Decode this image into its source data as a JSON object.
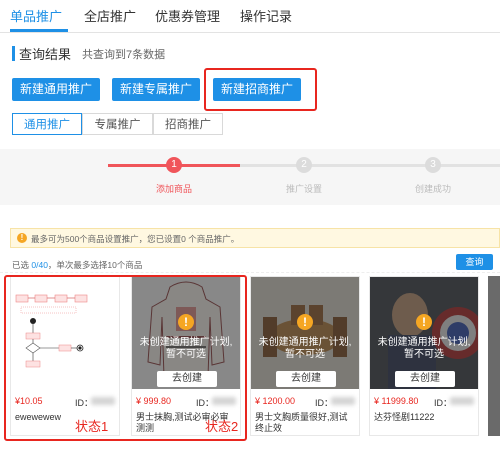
{
  "top_tabs": [
    "单品推广",
    "全店推广",
    "优惠券管理",
    "操作记录"
  ],
  "results": {
    "title": "查询结果",
    "count_text": "共查询到7条数据"
  },
  "buttons": {
    "general": "新建通用推广",
    "exclusive": "新建专属推广",
    "merchant": "新建招商推广"
  },
  "sub_tabs": [
    "通用推广",
    "专属推广",
    "招商推广"
  ],
  "steps": [
    {
      "num": "1",
      "label": "添加商品",
      "state": "active"
    },
    {
      "num": "2",
      "label": "推广设置",
      "state": "inactive"
    },
    {
      "num": "3",
      "label": "创建成功",
      "state": "inactive"
    }
  ],
  "notice": {
    "text": "最多可为500个商品设置推广，您已设置0 个商品推广。"
  },
  "selection": {
    "prefix": "已选 ",
    "count": "0/40",
    "suffix": "，单次最多选择10个商品"
  },
  "query_button": "查询",
  "cards": [
    {
      "price": "¥10.05",
      "id_label": "ID：",
      "name": "ewewewew",
      "disabled": false
    },
    {
      "price": "¥ 999.80",
      "id_label": "ID：",
      "name": "男士抹胸,测试必审必审测测",
      "disabled": true,
      "warn_text": "未创建通用推广计划,暂不可选",
      "create_label": "去创建"
    },
    {
      "price": "¥ 1200.00",
      "id_label": "ID：",
      "name": "男士文胸质量很好,测试终止效",
      "disabled": true,
      "warn_text": "未创建通用推广计划,暂不可选",
      "create_label": "去创建"
    },
    {
      "price": "¥ 11999.80",
      "id_label": "ID：",
      "name": "达芬怪剧11222",
      "disabled": true,
      "warn_text": "未创建通用推广计划,暂不可选",
      "create_label": "去创建"
    }
  ],
  "annotations": {
    "state1": "状态1",
    "state2": "状态2"
  },
  "colors": {
    "accent": "#1e90e6",
    "highlight": "#e8261f",
    "price": "#e8261f",
    "warning": "#f5a623"
  }
}
